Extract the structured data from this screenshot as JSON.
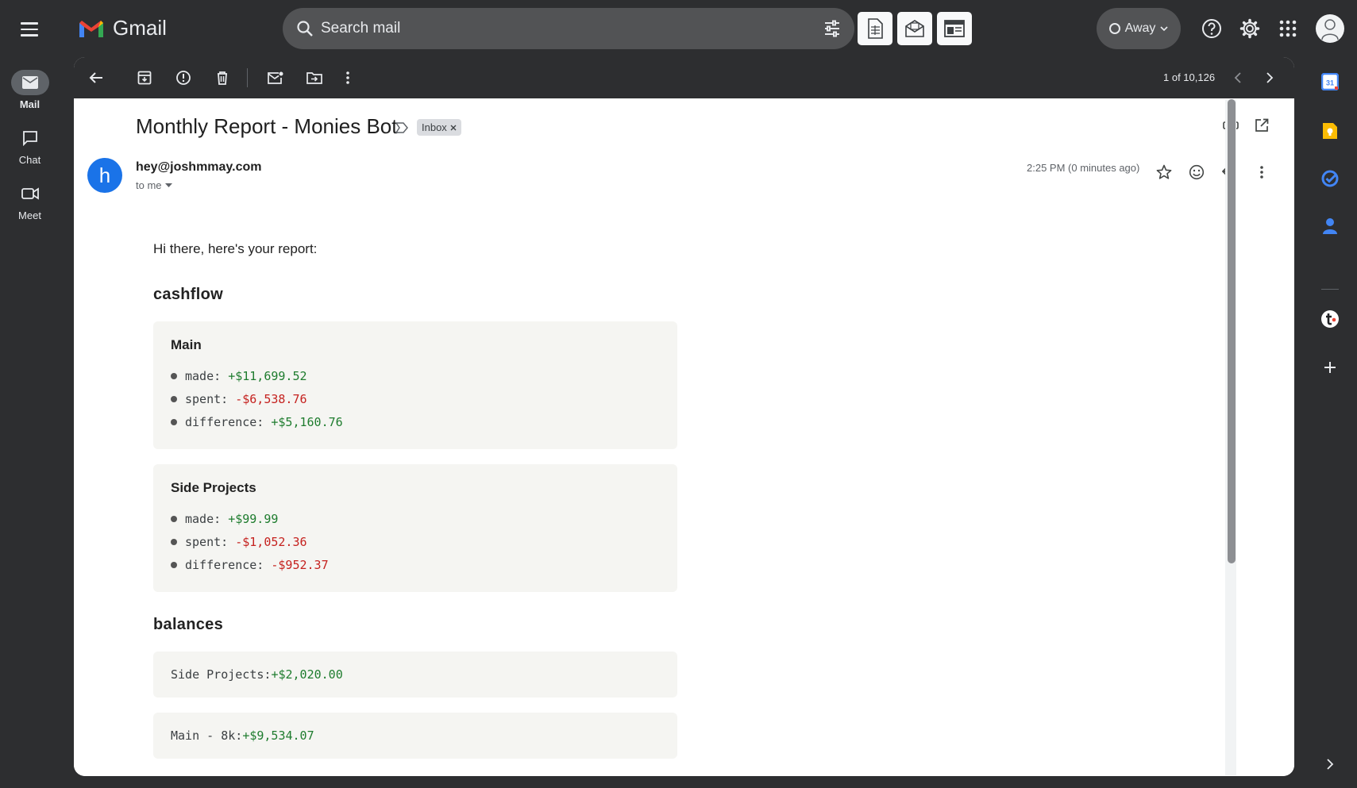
{
  "app": {
    "name": "Gmail"
  },
  "search": {
    "placeholder": "Search mail"
  },
  "status": {
    "label": "Away"
  },
  "nav": [
    {
      "label": "Mail"
    },
    {
      "label": "Chat"
    },
    {
      "label": "Meet"
    }
  ],
  "pager": {
    "text": "1 of 10,126"
  },
  "email": {
    "subject": "Monthly Report - Monies Bot",
    "label_chip": "Inbox",
    "sender_initial": "h",
    "sender": "hey@joshmmay.com",
    "recipient": "to me",
    "timestamp": "2:25 PM (0 minutes ago)",
    "greeting": "Hi there, here's your report:"
  },
  "cashflow": {
    "title": "cashflow",
    "groups": [
      {
        "title": "Main",
        "rows": [
          {
            "label": "made: ",
            "value": "+$11,699.52"
          },
          {
            "label": "spent: ",
            "value": "-$6,538.76"
          },
          {
            "label": "difference: ",
            "value": "+$5,160.76"
          }
        ]
      },
      {
        "title": "Side Projects",
        "rows": [
          {
            "label": "made: ",
            "value": "+$99.99"
          },
          {
            "label": "spent: ",
            "value": "-$1,052.36"
          },
          {
            "label": "difference: ",
            "value": "-$952.37"
          }
        ]
      }
    ]
  },
  "balances": {
    "title": "balances",
    "items": [
      {
        "label": "Side Projects:",
        "value": "+$2,020.00"
      },
      {
        "label": "Main - 8k:",
        "value": "+$9,534.07"
      }
    ]
  },
  "colors": {
    "positive": "#1e7c2e",
    "negative": "#c5221f",
    "accent": "#1a73e8"
  }
}
